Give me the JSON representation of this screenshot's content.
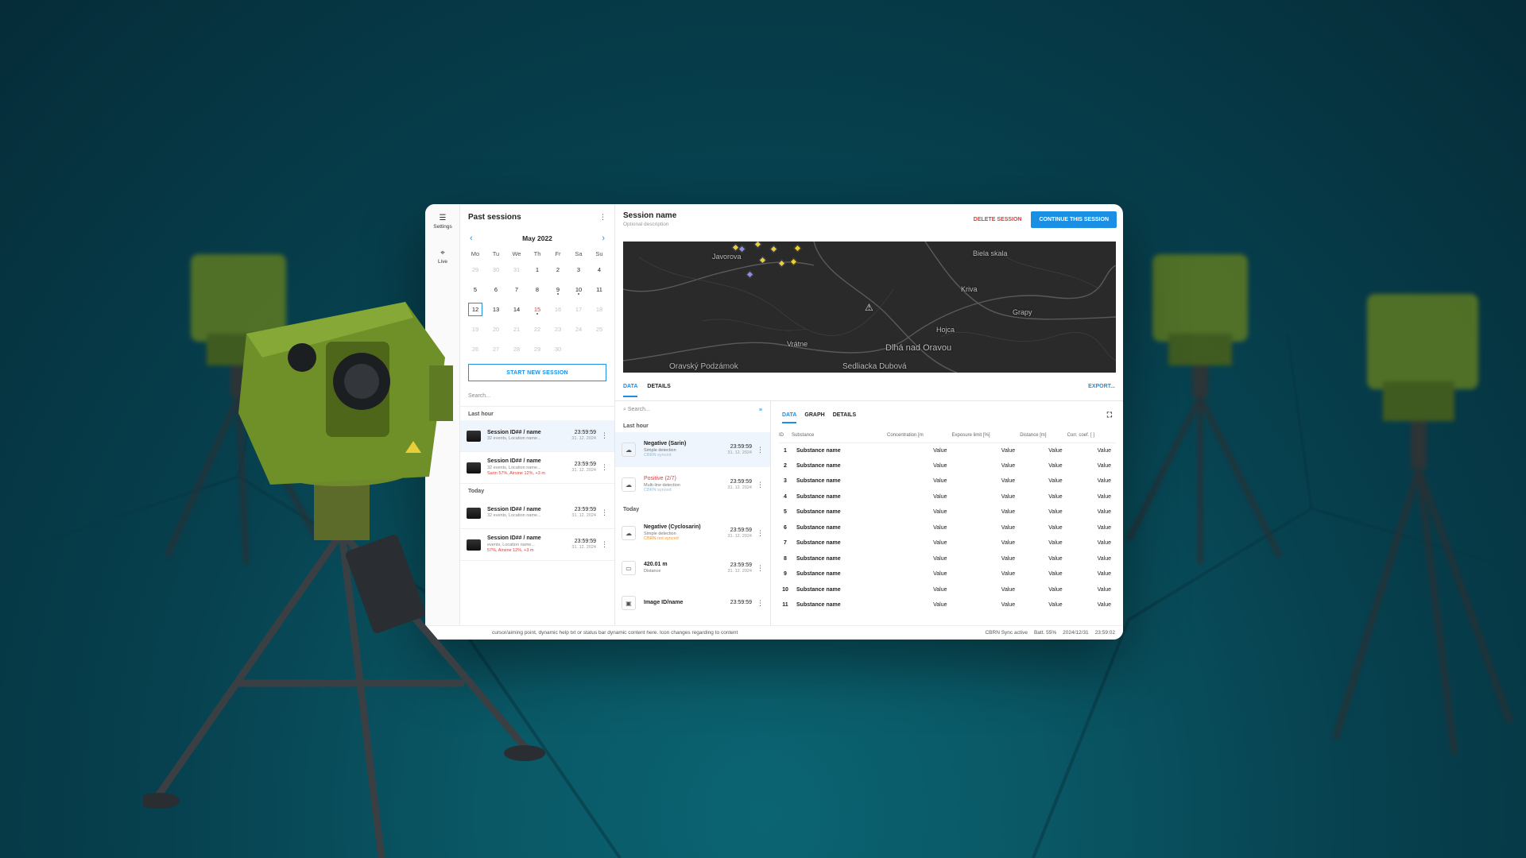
{
  "rail": [
    {
      "label": "Settings",
      "icon": "sliders-icon"
    },
    {
      "label": "Live",
      "icon": "crosshair-icon"
    }
  ],
  "rail_bottom": {
    "label": "Mute",
    "icon": "speaker-icon"
  },
  "past_sessions": {
    "title": "Past sessions",
    "month": "May 2022",
    "weekdays": [
      "Mo",
      "Tu",
      "We",
      "Th",
      "Fr",
      "Sa",
      "Su"
    ],
    "days": [
      [
        "29",
        "30",
        "31",
        "1",
        "2",
        "3",
        "4"
      ],
      [
        "5",
        "6",
        "7",
        "8",
        "9",
        "10",
        "11"
      ],
      [
        "12",
        "13",
        "14",
        "15",
        "16",
        "17",
        "18"
      ],
      [
        "19",
        "20",
        "21",
        "22",
        "23",
        "24",
        "25"
      ],
      [
        "26",
        "27",
        "28",
        "29",
        "30",
        "",
        ""
      ]
    ],
    "new_session": "START NEW SESSION",
    "search_placeholder": "Search...",
    "groups": {
      "last_hour": "Last hour",
      "today": "Today"
    },
    "sessions": [
      {
        "name": "Session ID## / name",
        "sub": "32 events, Location name...",
        "warn": "",
        "time": "23:59:59",
        "date": "31. 12. 2024"
      },
      {
        "name": "Session ID## / name",
        "sub": "32 events, Location name...",
        "warn": "Sarin 57%, Airsine 12%, +3 m",
        "time": "23:59:59",
        "date": "31. 12. 2024"
      },
      {
        "name": "Session ID## / name",
        "sub": "32 events, Location name...",
        "warn": "",
        "time": "23:59:59",
        "date": "31. 12. 2024"
      },
      {
        "name": "Session ID## / name",
        "sub": "events, Location name...",
        "warn": "57%, Airsine 12%, +3 m",
        "time": "23:59:59",
        "date": "31. 12. 2024"
      }
    ]
  },
  "session": {
    "title": "Session name",
    "description": "Optional description",
    "delete": "DELETE SESSION",
    "continue": "CONTINUE THIS SESSION",
    "export": "EXPORT...",
    "tabs": [
      "DATA",
      "DETAILS"
    ]
  },
  "map": {
    "labels": [
      "Javorova",
      "Biela skala",
      "Kriva",
      "Grapy",
      "Hojca",
      "Vrátne",
      "Dlhá nad Oravou",
      "Oravský Podzámok",
      "Sedliacka Dubová"
    ]
  },
  "events": {
    "search_placeholder": "Search...",
    "groups": {
      "last_hour": "Last hour",
      "today": "Today"
    },
    "items": [
      {
        "name": "Negative (Sarin)",
        "sub": "Simple detection",
        "sub2": "CBRN synced",
        "time": "23:59:59",
        "date": "31. 12. 2024"
      },
      {
        "name": "Positive (2/7)",
        "sub": "Multi-line detection",
        "sub2": "CBRN synced",
        "time": "23:59:59",
        "date": "31. 12. 2024"
      },
      {
        "name": "Negative (Cyclosarin)",
        "sub": "Simple detection",
        "sub2": "CBRN not synced",
        "time": "23:59:59",
        "date": "31. 12. 2024"
      },
      {
        "name": "420.01 m",
        "sub": "Distance",
        "sub2": "",
        "time": "23:59:59",
        "date": "31. 12. 2024"
      },
      {
        "name": "Image ID/name",
        "sub": "",
        "sub2": "",
        "time": "23:59:59",
        "date": ""
      }
    ]
  },
  "table": {
    "tabs": [
      "DATA",
      "GRAPH",
      "DETAILS"
    ],
    "columns": [
      "ID",
      "Substance",
      "Concentration [m",
      "Exposure limit [%]",
      "Distance [m]",
      "Corr. coef. [ ]"
    ],
    "rows": [
      [
        "1",
        "Substance name",
        "Value",
        "Value",
        "Value",
        "Value"
      ],
      [
        "2",
        "Substance name",
        "Value",
        "Value",
        "Value",
        "Value"
      ],
      [
        "3",
        "Substance name",
        "Value",
        "Value",
        "Value",
        "Value"
      ],
      [
        "4",
        "Substance name",
        "Value",
        "Value",
        "Value",
        "Value"
      ],
      [
        "5",
        "Substance name",
        "Value",
        "Value",
        "Value",
        "Value"
      ],
      [
        "6",
        "Substance name",
        "Value",
        "Value",
        "Value",
        "Value"
      ],
      [
        "7",
        "Substance name",
        "Value",
        "Value",
        "Value",
        "Value"
      ],
      [
        "8",
        "Substance name",
        "Value",
        "Value",
        "Value",
        "Value"
      ],
      [
        "9",
        "Substance name",
        "Value",
        "Value",
        "Value",
        "Value"
      ],
      [
        "10",
        "Substance name",
        "Value",
        "Value",
        "Value",
        "Value"
      ],
      [
        "11",
        "Substance name",
        "Value",
        "Value",
        "Value",
        "Value"
      ]
    ]
  },
  "status": {
    "help": "cursor/aiming point, dynamic help txt or status bar dynamic content here. Icon changes regarding to content",
    "sync": "CBRN Sync active",
    "battery": "Batt. 55%",
    "date": "2024/12/31",
    "time": "23:59:02"
  },
  "colors": {
    "accent": "#1a8fe3",
    "danger": "#e53935",
    "warning": "#ef9a3a"
  }
}
